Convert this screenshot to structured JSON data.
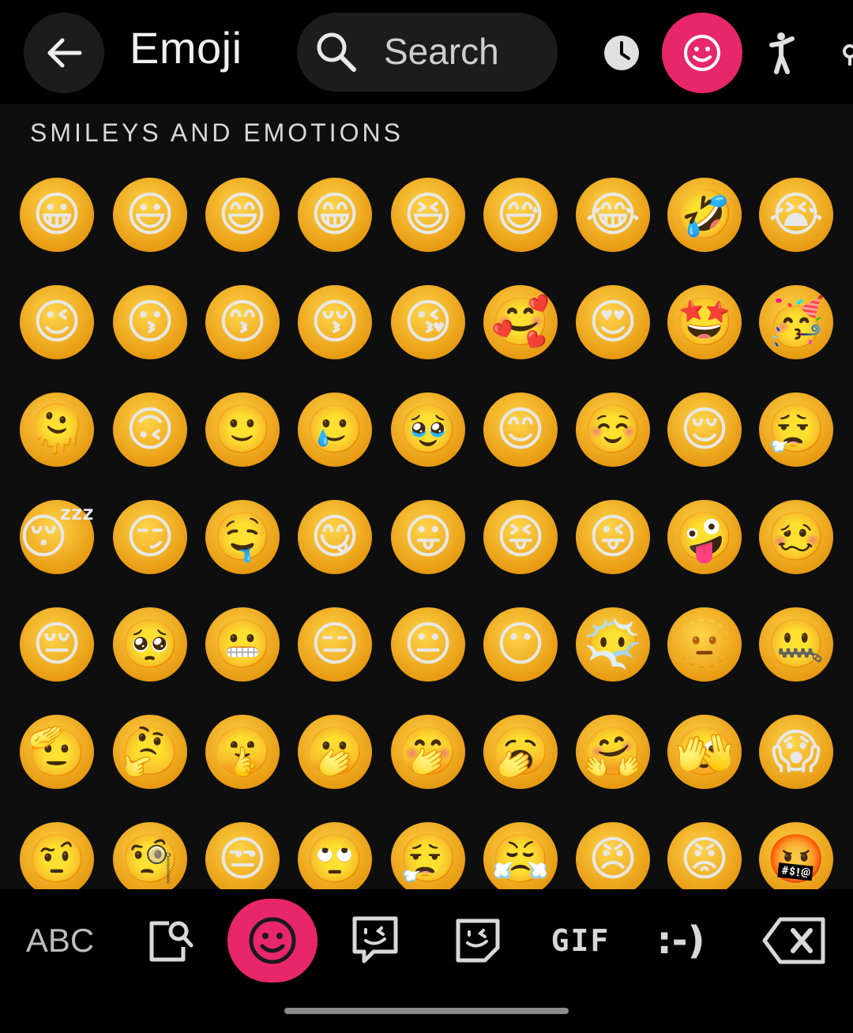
{
  "header": {
    "title": "Emoji",
    "search_placeholder": "Search"
  },
  "categories": [
    {
      "name": "recent",
      "active": false
    },
    {
      "name": "smileys",
      "active": true
    },
    {
      "name": "people",
      "active": false
    },
    {
      "name": "objects",
      "active": false
    }
  ],
  "section": {
    "label": "SMILEYS AND EMOTIONS"
  },
  "emoji_rows": [
    [
      "😀",
      "😃",
      "😄",
      "😁",
      "😆",
      "😅",
      "😂",
      "🤣",
      "😭"
    ],
    [
      "😉",
      "😗",
      "😙",
      "😚",
      "😘",
      "🥰",
      "😍",
      "🤩",
      "🥳"
    ],
    [
      "🫠",
      "🙃",
      "🙂",
      "🥲",
      "🥹",
      "😊",
      "☺️",
      "😌",
      "😮‍💨"
    ],
    [
      "😴",
      "😏",
      "🤤",
      "😋",
      "😛",
      "😝",
      "😜",
      "🤪",
      "🥴"
    ],
    [
      "😔",
      "🥺",
      "😬",
      "😑",
      "😐",
      "😶",
      "😶‍🌫️",
      "🫥",
      "🤐"
    ],
    [
      "🫡",
      "🤔",
      "🤫",
      "🫢",
      "🤭",
      "🥱",
      "🤗",
      "🫣",
      "😱"
    ],
    [
      "🤨",
      "🧐",
      "😒",
      "🙄",
      "😮‍💨",
      "😤",
      "😠",
      "😡",
      "🤬"
    ]
  ],
  "bottom_bar": {
    "abc_label": "ABC",
    "gif_label": "GIF",
    "emoticon_label": ":-)"
  },
  "colors": {
    "accent": "#e8266a",
    "background": "#000000",
    "panel": "#0e0e0e"
  }
}
